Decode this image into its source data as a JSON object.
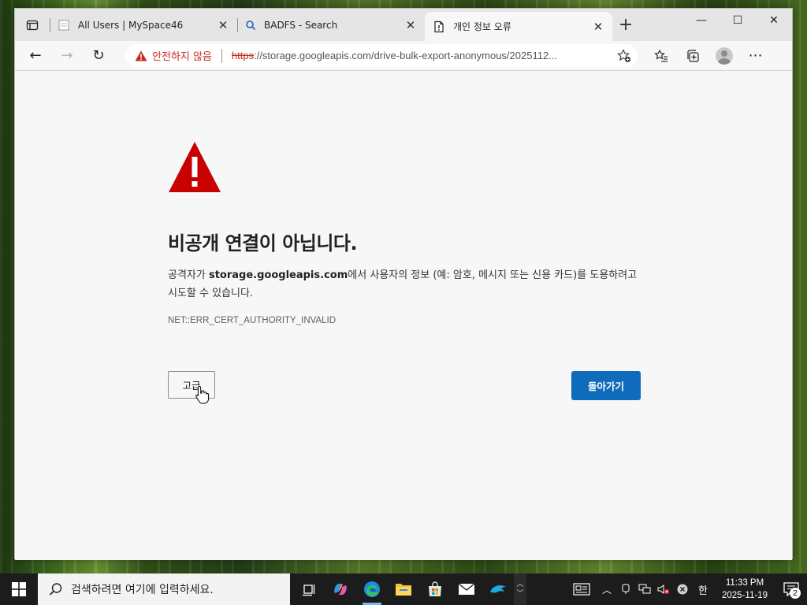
{
  "tabs": [
    {
      "title": "All Users | MySpace46",
      "icon": "page-icon"
    },
    {
      "title": "BADFS - Search",
      "icon": "search-icon"
    },
    {
      "title": "개인 정보 오류",
      "icon": "insecure-page-icon"
    }
  ],
  "toolbar": {
    "security_label": "안전하지 않음",
    "url_scheme": "https",
    "url_rest": "://storage.googleapis.com/drive-bulk-export-anonymous/2025112..."
  },
  "error": {
    "title": "비공개 연결이 아닙니다.",
    "desc_prefix": "공격자가 ",
    "desc_host": "storage.googleapis.com",
    "desc_suffix": "에서 사용자의 정보 (예: 암호, 메시지 또는 신용 카드)를 도용하려고 시도할 수 있습니다.",
    "code": "NET::ERR_CERT_AUTHORITY_INVALID",
    "advanced_label": "고급",
    "back_label": "돌아가기"
  },
  "taskbar": {
    "search_placeholder": "검색하려면 여기에 입력하세요.",
    "ime_label": "한",
    "time": "11:33 PM",
    "date": "2025-11-19",
    "notification_count": "2"
  },
  "colors": {
    "accent_blue": "#0f6cbd",
    "warning_red": "#c80000",
    "insecure_red": "#c42b1c"
  }
}
